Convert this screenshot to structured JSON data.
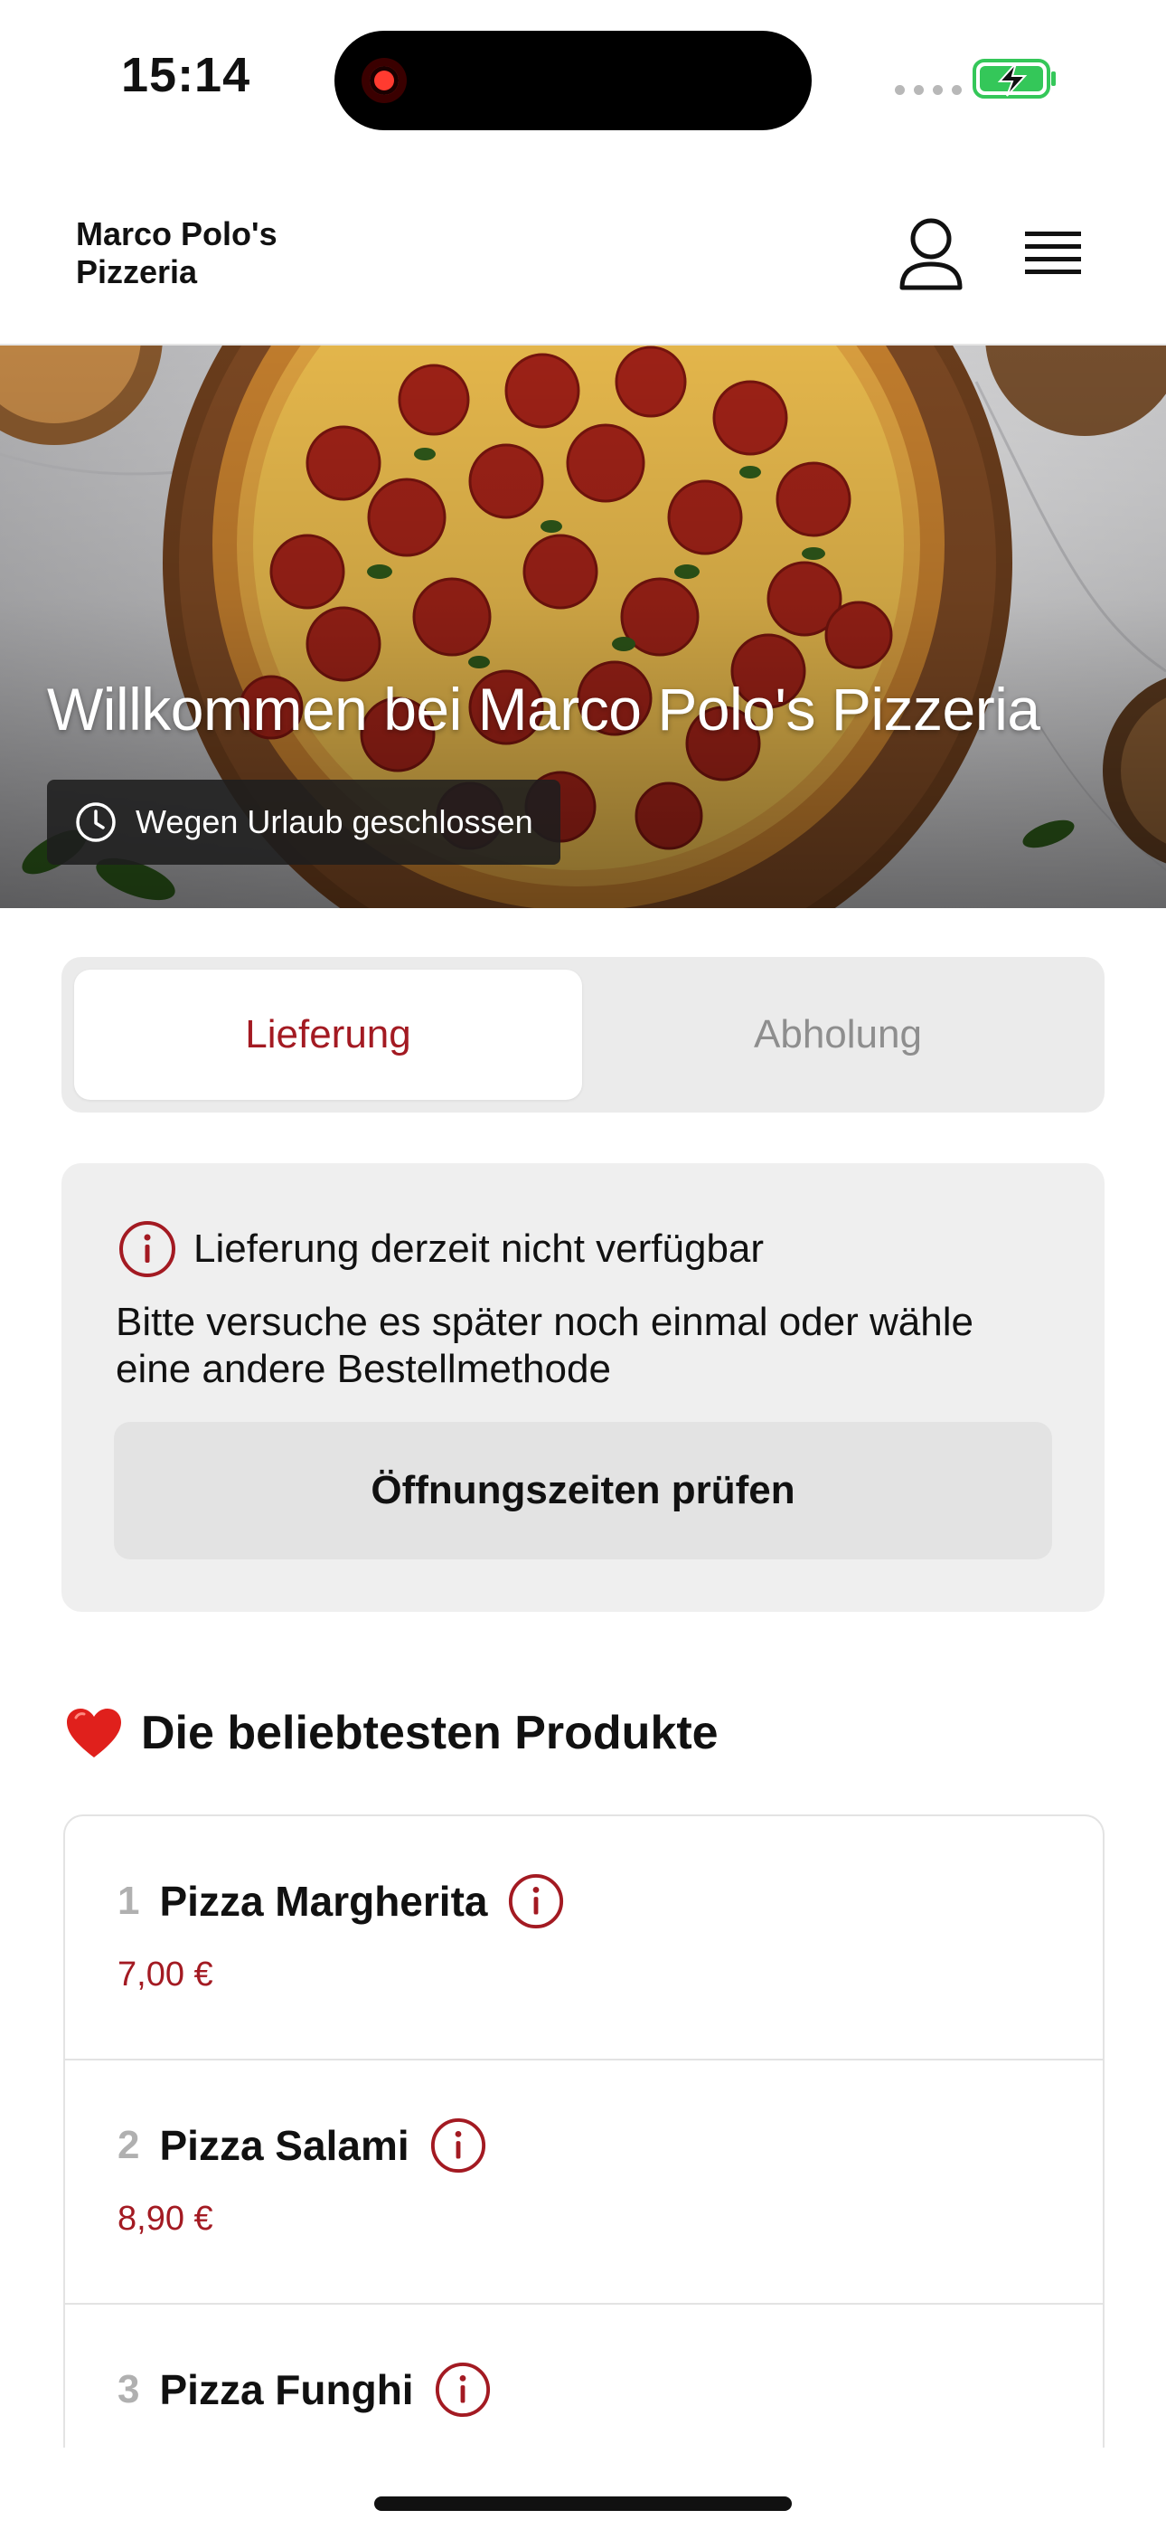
{
  "status_bar": {
    "time": "15:14",
    "battery_state": "charging",
    "battery_color": "#34c759"
  },
  "header": {
    "brand_line1": "Marco Polo's",
    "brand_line2": "Pizzeria",
    "user_icon": "user-icon",
    "menu_icon": "hamburger-menu-icon"
  },
  "hero": {
    "title": "Willkommen bei Marco Polo's Pizzeria",
    "badge_icon": "clock-icon",
    "badge_label": "Wegen Urlaub geschlossen"
  },
  "order_mode": {
    "tabs": [
      {
        "label": "Lieferung",
        "active": true
      },
      {
        "label": "Abholung",
        "active": false
      }
    ]
  },
  "delivery_alert": {
    "icon": "info-icon",
    "title": "Lieferung derzeit nicht verfügbar",
    "text": "Bitte versuche es später noch einmal oder wähle eine andere Bestellmethode",
    "button_label": "Öffnungszeiten prüfen"
  },
  "popular": {
    "emoji": "❤️",
    "title": "Die beliebtesten Produkte",
    "items": [
      {
        "rank": "1",
        "name": "Pizza Margherita",
        "price": "7,00 €"
      },
      {
        "rank": "2",
        "name": "Pizza Salami",
        "price": "8,90 €"
      },
      {
        "rank": "3",
        "name": "Pizza Funghi",
        "price": ""
      }
    ]
  },
  "colors": {
    "accent": "#a31a22",
    "card_bg": "#efefef",
    "muted": "#8e8e8e"
  }
}
